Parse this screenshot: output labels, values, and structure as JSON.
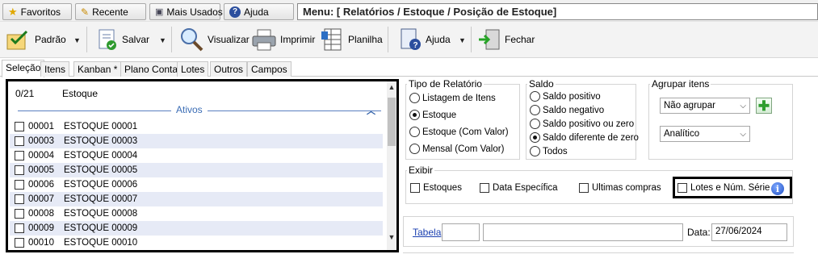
{
  "quickbar": {
    "favoritos": "Favoritos",
    "recente": "Recente",
    "mais_usados": "Mais Usados",
    "ajuda": "Ajuda",
    "menu_path": "Menu: [ Relatórios / Estoque / Posição de Estoque]"
  },
  "toolbar": {
    "padrao": "Padrão",
    "salvar": "Salvar",
    "visualizar": "Visualizar",
    "imprimir": "Imprimir",
    "planilha": "Planilha",
    "ajuda": "Ajuda",
    "fechar": "Fechar"
  },
  "tabs": [
    "Seleção",
    "Itens",
    "Kanban *",
    "Plano Conta",
    "Lotes",
    "Outros",
    "Campos"
  ],
  "list": {
    "count": "0/21",
    "column": "Estoque",
    "group": "Ativos",
    "rows": [
      {
        "code": "00001",
        "name": "ESTOQUE 00001"
      },
      {
        "code": "00003",
        "name": "ESTOQUE 00003"
      },
      {
        "code": "00004",
        "name": "ESTOQUE 00004"
      },
      {
        "code": "00005",
        "name": "ESTOQUE 00005"
      },
      {
        "code": "00006",
        "name": "ESTOQUE 00006"
      },
      {
        "code": "00007",
        "name": "ESTOQUE 00007"
      },
      {
        "code": "00008",
        "name": "ESTOQUE 00008"
      },
      {
        "code": "00009",
        "name": "ESTOQUE 00009"
      },
      {
        "code": "00010",
        "name": "ESTOQUE 00010"
      }
    ]
  },
  "tipo_relatorio": {
    "legend": "Tipo de Relatório",
    "options": [
      "Listagem de Itens",
      "Estoque",
      "Estoque (Com Valor)",
      "Mensal (Com Valor)"
    ],
    "selected": "Estoque"
  },
  "saldo": {
    "legend": "Saldo",
    "options": [
      "Saldo positivo",
      "Saldo negativo",
      "Saldo positivo ou zero",
      "Saldo diferente de zero",
      "Todos"
    ],
    "selected": "Saldo diferente de zero"
  },
  "agrupar": {
    "legend": "Agrupar itens",
    "group_value": "Não agrupar",
    "mode_value": "Analítico"
  },
  "exibir": {
    "legend": "Exibir",
    "estoques": "Estoques",
    "data_especifica": "Data Específica",
    "ultimas_compras": "Ultimas compras",
    "lotes": "Lotes e Núm. Série"
  },
  "tabela": {
    "label": "Tabela",
    "code_value": "",
    "desc_value": "",
    "data_label": "Data:",
    "data_value": "27/06/2024"
  }
}
